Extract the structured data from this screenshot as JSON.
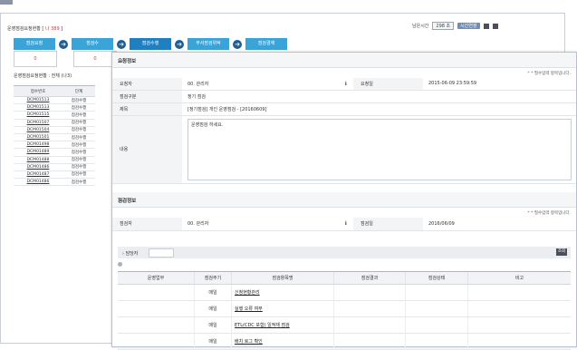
{
  "header": {
    "title": "운영점검요청현황 [",
    "title_count": "나 389",
    "title_end": "]",
    "remain_label": "남은시간",
    "remain_value": "298 초",
    "extend_button": "시간연장"
  },
  "steps": [
    {
      "label": "점검요청",
      "value": "0"
    },
    {
      "label": "점검수",
      "value": "0"
    },
    {
      "label": "점검수행",
      "value": ""
    },
    {
      "label": "무서점검위탁",
      "value": ""
    },
    {
      "label": "점검결재",
      "value": ""
    }
  ],
  "list": {
    "subtitle": "운영점검요청현황 : 전체 (나3)",
    "columns": [
      "접수번호",
      "단계"
    ],
    "rows": [
      [
        "DCM01513",
        "점검수행"
      ],
      [
        "DCM01513",
        "점검수행"
      ],
      [
        "DCM01515",
        "점검수행"
      ],
      [
        "DCM01507",
        "점검수행"
      ],
      [
        "DCM01504",
        "점검수행"
      ],
      [
        "DCM01501",
        "점검수행"
      ],
      [
        "DCM01498",
        "점검수행"
      ],
      [
        "DCM01489",
        "점검수행"
      ],
      [
        "DCM01488",
        "점검수행"
      ],
      [
        "DCM01486",
        "점검수행"
      ],
      [
        "DCM01487",
        "점검수행"
      ],
      [
        "DCM01486",
        "점검수행"
      ]
    ]
  },
  "request": {
    "section_title": "요청정보",
    "required_note": "* 필수입력 항목입니다.",
    "requester_label": "요청자",
    "requester_value": "00. 관리자",
    "request_date_label": "요청일",
    "request_date_value": "2015-06-09 23:59:59",
    "type_label": "점검구분",
    "type_value": "정기 점검",
    "subject_label": "제목",
    "subject_value": "[정기점검] 개인 운영점검 - [20160609]",
    "content_label": "내용",
    "content_value": "운영점검 하세요."
  },
  "inspection": {
    "section_title": "점검정보",
    "required_note": "* 필수입력 항목입니다.",
    "inspector_label": "점검자",
    "inspector_value": "00. 관리자",
    "date_label": "점검일",
    "date_value": "2016/06/09",
    "assignee_label": "담당자",
    "search_button": "조회",
    "columns": [
      "운영업무",
      "점검주기",
      "점검항목명",
      "점검결과",
      "점검상태",
      "비고"
    ],
    "rows": [
      [
        "",
        "매일",
        "신청현황관리",
        "",
        "",
        ""
      ],
      [
        "",
        "매일",
        "실행 오류 여부",
        "",
        "",
        ""
      ],
      [
        "",
        "매일",
        "ETL(CDC 포함) 일적재 점검",
        "",
        "",
        ""
      ],
      [
        "",
        "매일",
        "배치 로그 확인",
        "",
        "",
        ""
      ]
    ]
  }
}
